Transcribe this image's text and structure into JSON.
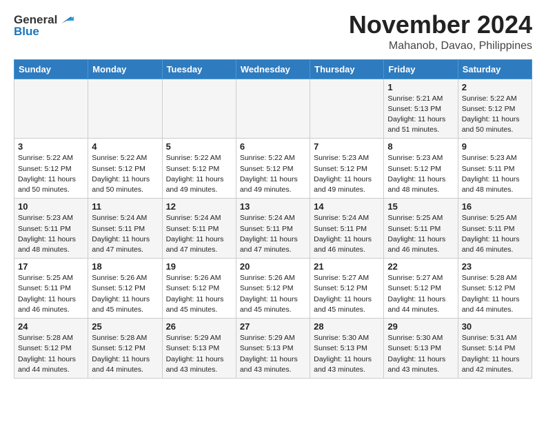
{
  "logo": {
    "line1": "General",
    "line2": "Blue"
  },
  "title": "November 2024",
  "subtitle": "Mahanob, Davao, Philippines",
  "days_of_week": [
    "Sunday",
    "Monday",
    "Tuesday",
    "Wednesday",
    "Thursday",
    "Friday",
    "Saturday"
  ],
  "weeks": [
    [
      {
        "day": "",
        "info": ""
      },
      {
        "day": "",
        "info": ""
      },
      {
        "day": "",
        "info": ""
      },
      {
        "day": "",
        "info": ""
      },
      {
        "day": "",
        "info": ""
      },
      {
        "day": "1",
        "info": "Sunrise: 5:21 AM\nSunset: 5:13 PM\nDaylight: 11 hours\nand 51 minutes."
      },
      {
        "day": "2",
        "info": "Sunrise: 5:22 AM\nSunset: 5:12 PM\nDaylight: 11 hours\nand 50 minutes."
      }
    ],
    [
      {
        "day": "3",
        "info": "Sunrise: 5:22 AM\nSunset: 5:12 PM\nDaylight: 11 hours\nand 50 minutes."
      },
      {
        "day": "4",
        "info": "Sunrise: 5:22 AM\nSunset: 5:12 PM\nDaylight: 11 hours\nand 50 minutes."
      },
      {
        "day": "5",
        "info": "Sunrise: 5:22 AM\nSunset: 5:12 PM\nDaylight: 11 hours\nand 49 minutes."
      },
      {
        "day": "6",
        "info": "Sunrise: 5:22 AM\nSunset: 5:12 PM\nDaylight: 11 hours\nand 49 minutes."
      },
      {
        "day": "7",
        "info": "Sunrise: 5:23 AM\nSunset: 5:12 PM\nDaylight: 11 hours\nand 49 minutes."
      },
      {
        "day": "8",
        "info": "Sunrise: 5:23 AM\nSunset: 5:12 PM\nDaylight: 11 hours\nand 48 minutes."
      },
      {
        "day": "9",
        "info": "Sunrise: 5:23 AM\nSunset: 5:11 PM\nDaylight: 11 hours\nand 48 minutes."
      }
    ],
    [
      {
        "day": "10",
        "info": "Sunrise: 5:23 AM\nSunset: 5:11 PM\nDaylight: 11 hours\nand 48 minutes."
      },
      {
        "day": "11",
        "info": "Sunrise: 5:24 AM\nSunset: 5:11 PM\nDaylight: 11 hours\nand 47 minutes."
      },
      {
        "day": "12",
        "info": "Sunrise: 5:24 AM\nSunset: 5:11 PM\nDaylight: 11 hours\nand 47 minutes."
      },
      {
        "day": "13",
        "info": "Sunrise: 5:24 AM\nSunset: 5:11 PM\nDaylight: 11 hours\nand 47 minutes."
      },
      {
        "day": "14",
        "info": "Sunrise: 5:24 AM\nSunset: 5:11 PM\nDaylight: 11 hours\nand 46 minutes."
      },
      {
        "day": "15",
        "info": "Sunrise: 5:25 AM\nSunset: 5:11 PM\nDaylight: 11 hours\nand 46 minutes."
      },
      {
        "day": "16",
        "info": "Sunrise: 5:25 AM\nSunset: 5:11 PM\nDaylight: 11 hours\nand 46 minutes."
      }
    ],
    [
      {
        "day": "17",
        "info": "Sunrise: 5:25 AM\nSunset: 5:11 PM\nDaylight: 11 hours\nand 46 minutes."
      },
      {
        "day": "18",
        "info": "Sunrise: 5:26 AM\nSunset: 5:12 PM\nDaylight: 11 hours\nand 45 minutes."
      },
      {
        "day": "19",
        "info": "Sunrise: 5:26 AM\nSunset: 5:12 PM\nDaylight: 11 hours\nand 45 minutes."
      },
      {
        "day": "20",
        "info": "Sunrise: 5:26 AM\nSunset: 5:12 PM\nDaylight: 11 hours\nand 45 minutes."
      },
      {
        "day": "21",
        "info": "Sunrise: 5:27 AM\nSunset: 5:12 PM\nDaylight: 11 hours\nand 45 minutes."
      },
      {
        "day": "22",
        "info": "Sunrise: 5:27 AM\nSunset: 5:12 PM\nDaylight: 11 hours\nand 44 minutes."
      },
      {
        "day": "23",
        "info": "Sunrise: 5:28 AM\nSunset: 5:12 PM\nDaylight: 11 hours\nand 44 minutes."
      }
    ],
    [
      {
        "day": "24",
        "info": "Sunrise: 5:28 AM\nSunset: 5:12 PM\nDaylight: 11 hours\nand 44 minutes."
      },
      {
        "day": "25",
        "info": "Sunrise: 5:28 AM\nSunset: 5:12 PM\nDaylight: 11 hours\nand 44 minutes."
      },
      {
        "day": "26",
        "info": "Sunrise: 5:29 AM\nSunset: 5:13 PM\nDaylight: 11 hours\nand 43 minutes."
      },
      {
        "day": "27",
        "info": "Sunrise: 5:29 AM\nSunset: 5:13 PM\nDaylight: 11 hours\nand 43 minutes."
      },
      {
        "day": "28",
        "info": "Sunrise: 5:30 AM\nSunset: 5:13 PM\nDaylight: 11 hours\nand 43 minutes."
      },
      {
        "day": "29",
        "info": "Sunrise: 5:30 AM\nSunset: 5:13 PM\nDaylight: 11 hours\nand 43 minutes."
      },
      {
        "day": "30",
        "info": "Sunrise: 5:31 AM\nSunset: 5:14 PM\nDaylight: 11 hours\nand 42 minutes."
      }
    ]
  ]
}
